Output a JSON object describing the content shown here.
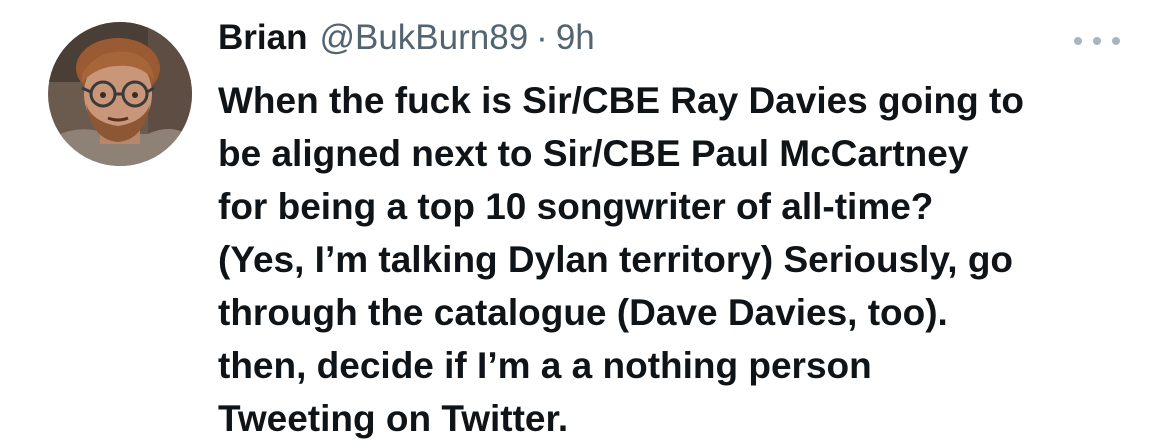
{
  "tweet": {
    "author": {
      "display_name": "Brian",
      "handle": "@BukBurn89",
      "separator": "·",
      "time": "9h"
    },
    "text_lines": [
      "When the fuck is Sir/CBE Ray Davies going to",
      "be aligned next to Sir/CBE Paul McCartney",
      "for being a top 10 songwriter of all-time?",
      "(Yes, I’m talking Dylan territory) Seriously, go",
      "through the catalogue (Dave Davies, too).",
      "then, decide if I’m a a nothing person",
      "Tweeting on Twitter."
    ],
    "icons": {
      "more": "more-horizontal-icon"
    },
    "colors": {
      "primary_text": "#0f1419",
      "secondary_text": "#536471",
      "more_dots": "#aab4bd",
      "background": "#ffffff"
    }
  }
}
